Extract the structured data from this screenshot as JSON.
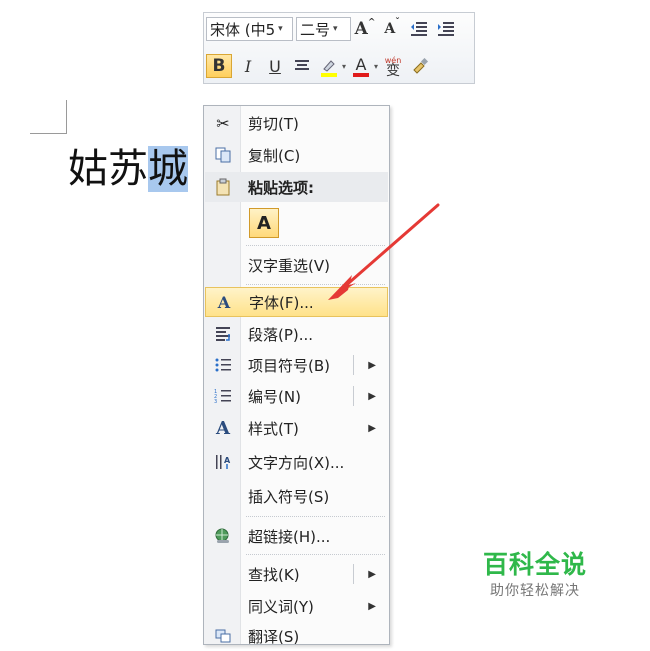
{
  "document": {
    "text_plain": "姑苏",
    "text_selected": "城"
  },
  "mini_toolbar": {
    "font_name": "宋体 (中5",
    "font_size": "二号",
    "grow_font": "A",
    "shrink_font": "A",
    "bold": "B",
    "italic": "I",
    "underline": "U",
    "font_color": "A",
    "phonetic": "wén",
    "phonetic_char": "变",
    "highlight_color": "#ffff00",
    "font_color_value": "#e01b1b"
  },
  "context_menu": {
    "cut": "剪切(T)",
    "copy": "复制(C)",
    "paste_options": "粘贴选项:",
    "paste_keep_text": "A",
    "reconvert": "汉字重选(V)",
    "font": "字体(F)...",
    "paragraph": "段落(P)...",
    "bullets": "项目符号(B)",
    "numbering": "编号(N)",
    "styles": "样式(T)",
    "text_direction": "文字方向(X)...",
    "insert_symbol": "插入符号(S)",
    "hyperlink": "超链接(H)...",
    "lookup": "查找(K)",
    "synonyms": "同义词(Y)",
    "translate": "翻译(S)"
  },
  "watermark": {
    "title": "百科全说",
    "subtitle": "助你轻松解决"
  },
  "colors": {
    "selection": "#a8c8ee",
    "menu_highlight": "#ffe28a",
    "arrow": "#e53935",
    "watermark_green": "#2fb84a"
  }
}
